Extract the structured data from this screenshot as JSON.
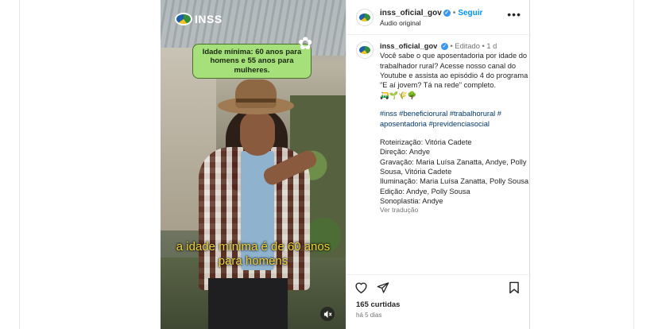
{
  "video": {
    "brand": "INSS",
    "caption_box": "Idade mínima: 60 anos para homens e 55 anos para mulheres.",
    "subtitle": "a idade mínima é de 60 anos para homens"
  },
  "header": {
    "username": "inss_oficial_gov",
    "separator": "•",
    "follow_label": "Seguir",
    "audio_label": "Áudio original",
    "more_label": "•••"
  },
  "post": {
    "username": "inss_oficial_gov",
    "meta": "• Editado • 1 d",
    "text": "Você sabe o que aposentadoria por idade do trabalhador rural? Acesse nosso canal do Youtube e assista ao episódio 4 do programa \"E aí jovem? Tá na rede\" completo.",
    "emojis": "🛺🌱🌾🌳",
    "hashtags": "#inss #beneficiorural #trabalhorural # aposentadoria #previdenciasocial",
    "credits": [
      "Roteirização: Vitória Cadete",
      "Direção: Andye",
      "Gravação: Maria Luísa Zanatta, Andye, Polly Sousa, Vitória Cadete",
      "Iluminação: Maria Luísa Zanatta, Polly Sousa",
      "Edição: Andye, Polly Sousa",
      "Sonoplastia: Andye"
    ],
    "translate_label": "Ver tradução"
  },
  "footer": {
    "likes": "165 curtidas",
    "time_ago": "há 5 dias"
  },
  "icons": {
    "like": "heart-icon",
    "share": "send-icon",
    "save": "bookmark-icon",
    "mute": "speaker-muted-icon"
  },
  "colors": {
    "follow": "#0095f6",
    "hashtag": "#00376b",
    "caption_box": "#a6e07a",
    "subtitle": "#f3d23b",
    "verified": "#3897f0"
  }
}
